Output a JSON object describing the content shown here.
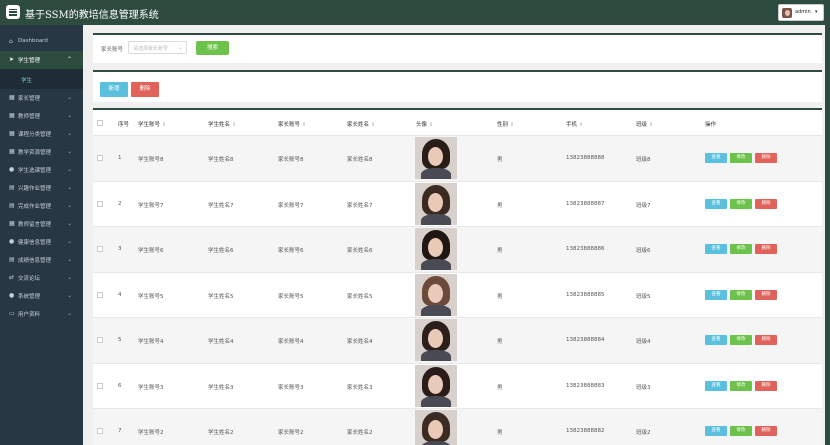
{
  "app": {
    "title": "基于SSM的教培信息管理系统",
    "user": "admin",
    "brand_color": "#2e4b40"
  },
  "sidebar": {
    "items": [
      {
        "label": "Dashboard",
        "icon": "home-icon",
        "has_children": false,
        "active": false
      },
      {
        "label": "学生管理",
        "icon": "send-icon",
        "has_children": true,
        "active": true,
        "expanded": true,
        "children": [
          {
            "label": "学生"
          }
        ]
      },
      {
        "label": "家长管理",
        "icon": "grid-icon",
        "has_children": true,
        "active": false
      },
      {
        "label": "教师管理",
        "icon": "grid-icon",
        "has_children": true,
        "active": false
      },
      {
        "label": "课程分类管理",
        "icon": "grid-icon",
        "has_children": true,
        "active": false
      },
      {
        "label": "教学资源管理",
        "icon": "grid-icon",
        "has_children": true,
        "active": false
      },
      {
        "label": "学生选课管理",
        "icon": "user-icon",
        "has_children": true,
        "active": false
      },
      {
        "label": "兴趣作业管理",
        "icon": "doc-icon",
        "has_children": true,
        "active": false
      },
      {
        "label": "完成作业管理",
        "icon": "doc-icon",
        "has_children": true,
        "active": false
      },
      {
        "label": "教师留言管理",
        "icon": "grid-icon",
        "has_children": true,
        "active": false
      },
      {
        "label": "健康信息管理",
        "icon": "user-icon",
        "has_children": true,
        "active": false
      },
      {
        "label": "成绩信息管理",
        "icon": "doc-icon",
        "has_children": true,
        "active": false
      },
      {
        "label": "交流论坛",
        "icon": "swap-icon",
        "has_children": true,
        "active": false
      },
      {
        "label": "系统管理",
        "icon": "pin-icon",
        "has_children": true,
        "active": false
      },
      {
        "label": "用户资料",
        "icon": "card-icon",
        "has_children": true,
        "active": false
      }
    ]
  },
  "search": {
    "label": "家长账号",
    "placeholder": "请选择家长账号",
    "button": "搜索"
  },
  "actions": {
    "add": "新增",
    "delete": "删除"
  },
  "table": {
    "columns": [
      "序号",
      "学生账号",
      "学生姓名",
      "家长账号",
      "家长姓名",
      "头像",
      "性别",
      "手机",
      "班级",
      "操作"
    ],
    "sortable": [
      false,
      true,
      true,
      true,
      true,
      true,
      true,
      true,
      true,
      false
    ],
    "row_ops": {
      "view": "查看",
      "edit": "修改",
      "delete": "删除"
    },
    "rows": [
      {
        "no": "1",
        "student_account": "学生账号8",
        "student_name": "学生姓名8",
        "parent_account": "家长账号8",
        "parent_name": "家长姓名8",
        "gender": "男",
        "phone": "13823888888",
        "class": "班级8"
      },
      {
        "no": "2",
        "student_account": "学生账号7",
        "student_name": "学生姓名7",
        "parent_account": "家长账号7",
        "parent_name": "家长姓名7",
        "gender": "男",
        "phone": "13823888887",
        "class": "班级7"
      },
      {
        "no": "3",
        "student_account": "学生账号6",
        "student_name": "学生姓名6",
        "parent_account": "家长账号6",
        "parent_name": "家长姓名6",
        "gender": "男",
        "phone": "13823888886",
        "class": "班级6"
      },
      {
        "no": "4",
        "student_account": "学生账号5",
        "student_name": "学生姓名5",
        "parent_account": "家长账号5",
        "parent_name": "家长姓名5",
        "gender": "男",
        "phone": "13823888885",
        "class": "班级5"
      },
      {
        "no": "5",
        "student_account": "学生账号4",
        "student_name": "学生姓名4",
        "parent_account": "家长账号4",
        "parent_name": "家长姓名4",
        "gender": "男",
        "phone": "13823888884",
        "class": "班级4"
      },
      {
        "no": "6",
        "student_account": "学生账号3",
        "student_name": "学生姓名3",
        "parent_account": "家长账号3",
        "parent_name": "家长姓名3",
        "gender": "男",
        "phone": "13823888883",
        "class": "班级3"
      },
      {
        "no": "7",
        "student_account": "学生账号2",
        "student_name": "学生姓名2",
        "parent_account": "家长账号2",
        "parent_name": "家长姓名2",
        "gender": "男",
        "phone": "13823888882",
        "class": "班级2"
      }
    ]
  }
}
